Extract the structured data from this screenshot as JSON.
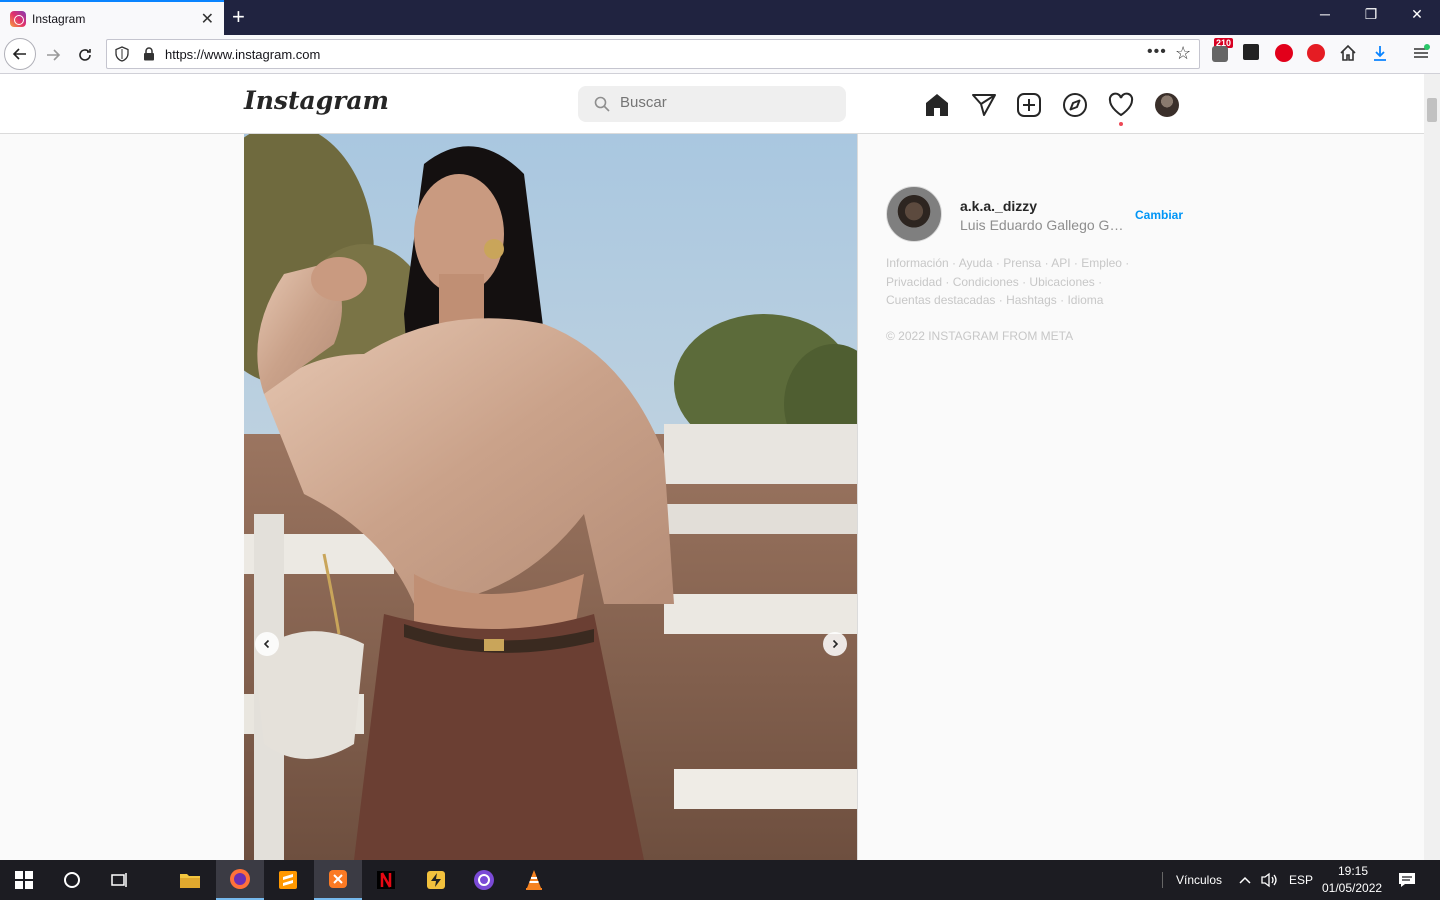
{
  "browser": {
    "tab_title": "Instagram",
    "tab_close": "✕",
    "new_tab": "+",
    "url": "https://www.instagram.com",
    "ext_badge_count": "210",
    "win_min": "─",
    "win_restore": "❐",
    "win_close": "✕"
  },
  "instagram": {
    "logo": "Instagram",
    "search_placeholder": "Buscar",
    "nav_icons": [
      "home-icon",
      "direct-icon",
      "new-post-icon",
      "explore-icon",
      "activity-icon",
      "profile-avatar"
    ]
  },
  "sidebar": {
    "username": "a.k.a._dizzy",
    "fullname": "Luis Eduardo Gallego Gar...",
    "switch_label": "Cambiar",
    "footer_links": [
      "Información",
      "Ayuda",
      "Prensa",
      "API",
      "Empleo",
      "Privacidad",
      "Condiciones",
      "Ubicaciones",
      "Cuentas destacadas",
      "Hashtags",
      "Idioma"
    ],
    "copyright": "© 2022 INSTAGRAM FROM META"
  },
  "taskbar": {
    "links_label": "Vínculos",
    "language": "ESP",
    "time": "19:15",
    "date": "01/05/2022"
  },
  "colors": {
    "accent": "#0095f6",
    "notif_dot": "#ed4956",
    "titlebar": "#202340",
    "taskbar": "#1c1c22"
  }
}
